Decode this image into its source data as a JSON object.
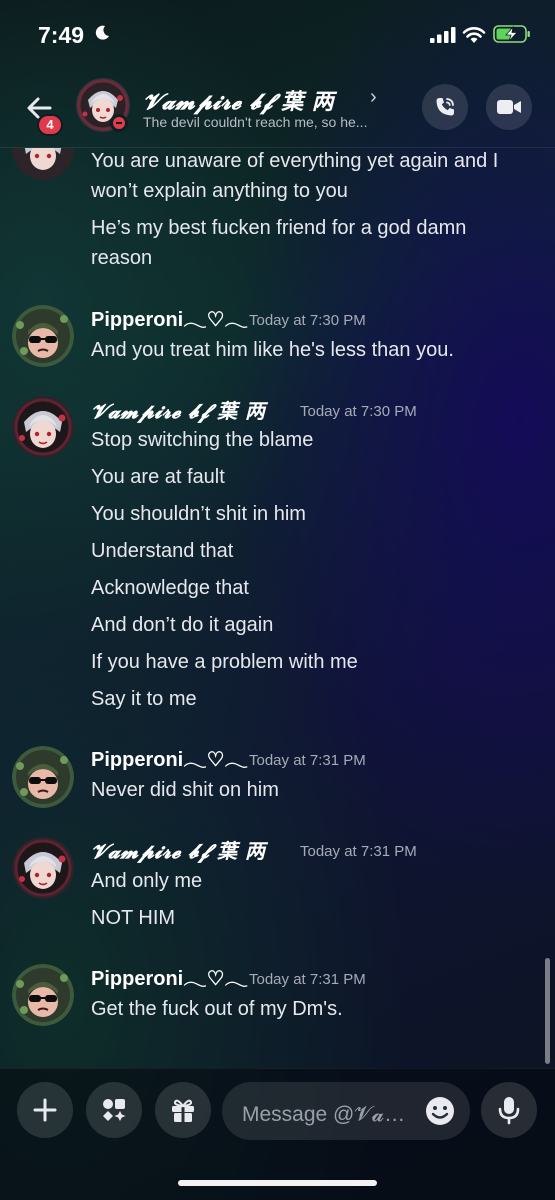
{
  "status_bar": {
    "time": "7:49",
    "icons": [
      "moon-icon",
      "signal-icon",
      "wifi-icon",
      "battery-charging-icon"
    ]
  },
  "header": {
    "unread_badge": "4",
    "name": "𝓥𝓪𝓶𝓹𝓲𝓻𝓮 𝓫𝓯 葉 两",
    "chevron": "›",
    "status": "The devil couldn't reach me, so he...",
    "icons": [
      "back-arrow-icon",
      "phone-call-icon",
      "video-camera-icon"
    ]
  },
  "messages": [
    {
      "lines": [
        "You are unaware of everything yet again and I",
        "won’t explain anything to you",
        "He’s my best fucken friend for a god damn",
        "reason"
      ]
    },
    {
      "author": "Pipperoni𓂃♡𓂃",
      "timestamp": "Today at 7:30 PM",
      "lines": [
        "And you treat him like he's less than you."
      ]
    },
    {
      "author": "𝓥𝓪𝓶𝓹𝓲𝓻𝓮 𝓫𝓯 葉 两",
      "timestamp": "Today at 7:30 PM",
      "lines": [
        "Stop switching the blame",
        "You are at fault",
        "You shouldn’t shit in him",
        "Understand that",
        "Acknowledge that",
        "And don’t do it again",
        "If you have a problem with me",
        "Say it to me"
      ]
    },
    {
      "author": "Pipperoni𓂃♡𓂃",
      "timestamp": "Today at 7:31 PM",
      "lines": [
        "Never did shit on him"
      ]
    },
    {
      "author": "𝓥𝓪𝓶𝓹𝓲𝓻𝓮 𝓫𝓯 葉 两",
      "timestamp": "Today at 7:31 PM",
      "lines": [
        "And only me",
        "NOT HIM"
      ]
    },
    {
      "author": "Pipperoni𓂃♡𓂃",
      "timestamp": "Today at 7:31 PM",
      "lines": [
        "Get the fuck out of my Dm's."
      ]
    }
  ],
  "composer": {
    "placeholder": "Message @𝓥𝓪𝓶𝓹𝓲𝓻𝓮 𝓫𝓯 葉 两",
    "icons": [
      "plus-icon",
      "apps-icon",
      "gift-icon",
      "emoji-icon",
      "microphone-icon"
    ]
  },
  "colors": {
    "badge": "#e0394b",
    "dnd": "#e23c48"
  }
}
